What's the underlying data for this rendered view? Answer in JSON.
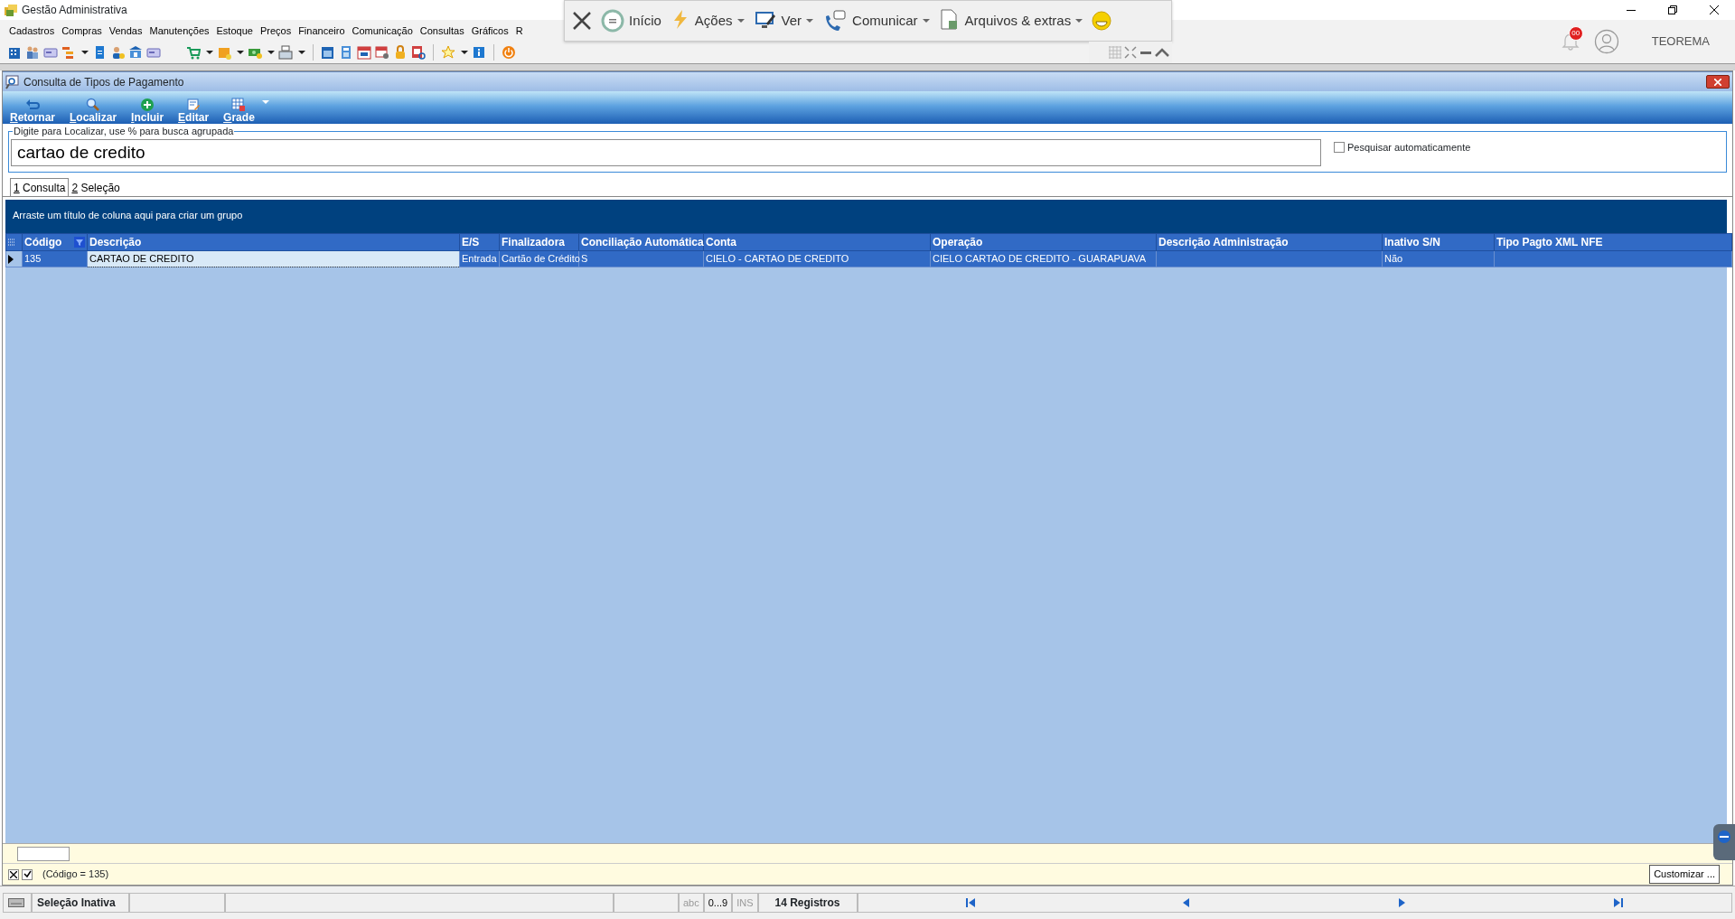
{
  "window": {
    "title": "Gestão Administrativa"
  },
  "menu": [
    "Cadastros",
    "Compras",
    "Vendas",
    "Manutenções",
    "Estoque",
    "Preços",
    "Financeiro",
    "Comunicação",
    "Consultas",
    "Gráficos",
    "R"
  ],
  "remote_bar": {
    "items": [
      {
        "label": "Início",
        "dropdown": false
      },
      {
        "label": "Ações",
        "dropdown": true
      },
      {
        "label": "Ver",
        "dropdown": true
      },
      {
        "label": "Comunicar",
        "dropdown": true
      },
      {
        "label": "Arquivos & extras",
        "dropdown": true
      }
    ]
  },
  "notifications": {
    "badge": "00"
  },
  "user": {
    "name": "TEOREMA"
  },
  "form": {
    "title": "Consulta de Tipos de Pagamento",
    "actions": [
      {
        "label": "Retornar",
        "kind": "return"
      },
      {
        "label": "Localizar",
        "kind": "search"
      },
      {
        "label": "Incluir",
        "kind": "add"
      },
      {
        "label": "Editar",
        "kind": "edit"
      },
      {
        "label": "Grade",
        "kind": "grid"
      }
    ],
    "search": {
      "legend": "Digite para Localizar, use % para busca agrupada",
      "value": "cartao de credito"
    },
    "auto_search": {
      "label": "Pesquisar automaticamente",
      "checked": false
    }
  },
  "tabs": [
    {
      "label": "1 Consulta",
      "selected": true
    },
    {
      "label": "2 Seleção",
      "selected": false
    }
  ],
  "grid": {
    "group_hint": "Arraste um título de coluna aqui para criar um grupo",
    "columns": [
      {
        "label": "Código",
        "filtered": true
      },
      {
        "label": "Descrição",
        "filtered": false
      },
      {
        "label": "E/S",
        "filtered": false
      },
      {
        "label": "Finalizadora",
        "filtered": false
      },
      {
        "label": "Conciliação Automática",
        "filtered": false
      },
      {
        "label": "Conta",
        "filtered": false
      },
      {
        "label": "Operação",
        "filtered": false
      },
      {
        "label": "Descrição Administração",
        "filtered": false
      },
      {
        "label": "Inativo S/N",
        "filtered": false
      },
      {
        "label": "Tipo Pagto XML NFE",
        "filtered": false
      }
    ],
    "rows": [
      {
        "selected": true,
        "cells": [
          {
            "text": "135",
            "focused": false
          },
          {
            "text": "CARTAO DE CREDITO",
            "focused": true
          },
          {
            "text": "Entrada",
            "focused": false
          },
          {
            "text": "Cartão de Crédito",
            "focused": false
          },
          {
            "text": "S",
            "focused": false
          },
          {
            "text": "CIELO - CARTAO DE CREDITO",
            "focused": false
          },
          {
            "text": "CIELO CARTAO DE CREDITO - GUARAPUAVA",
            "focused": false
          },
          {
            "focused": false
          },
          {
            "text": "Não",
            "focused": false
          },
          {
            "focused": false
          }
        ]
      }
    ]
  },
  "filter": {
    "enabled": true,
    "text": "(Código = 135)",
    "customize": "Customizar ..."
  },
  "status_bar": {
    "selection": "Seleção Inativa",
    "indicators": [
      {
        "label": "abc",
        "active": false
      },
      {
        "label": "0...9",
        "active": true
      },
      {
        "label": "INS",
        "active": false
      }
    ],
    "records": "14 Registros"
  }
}
